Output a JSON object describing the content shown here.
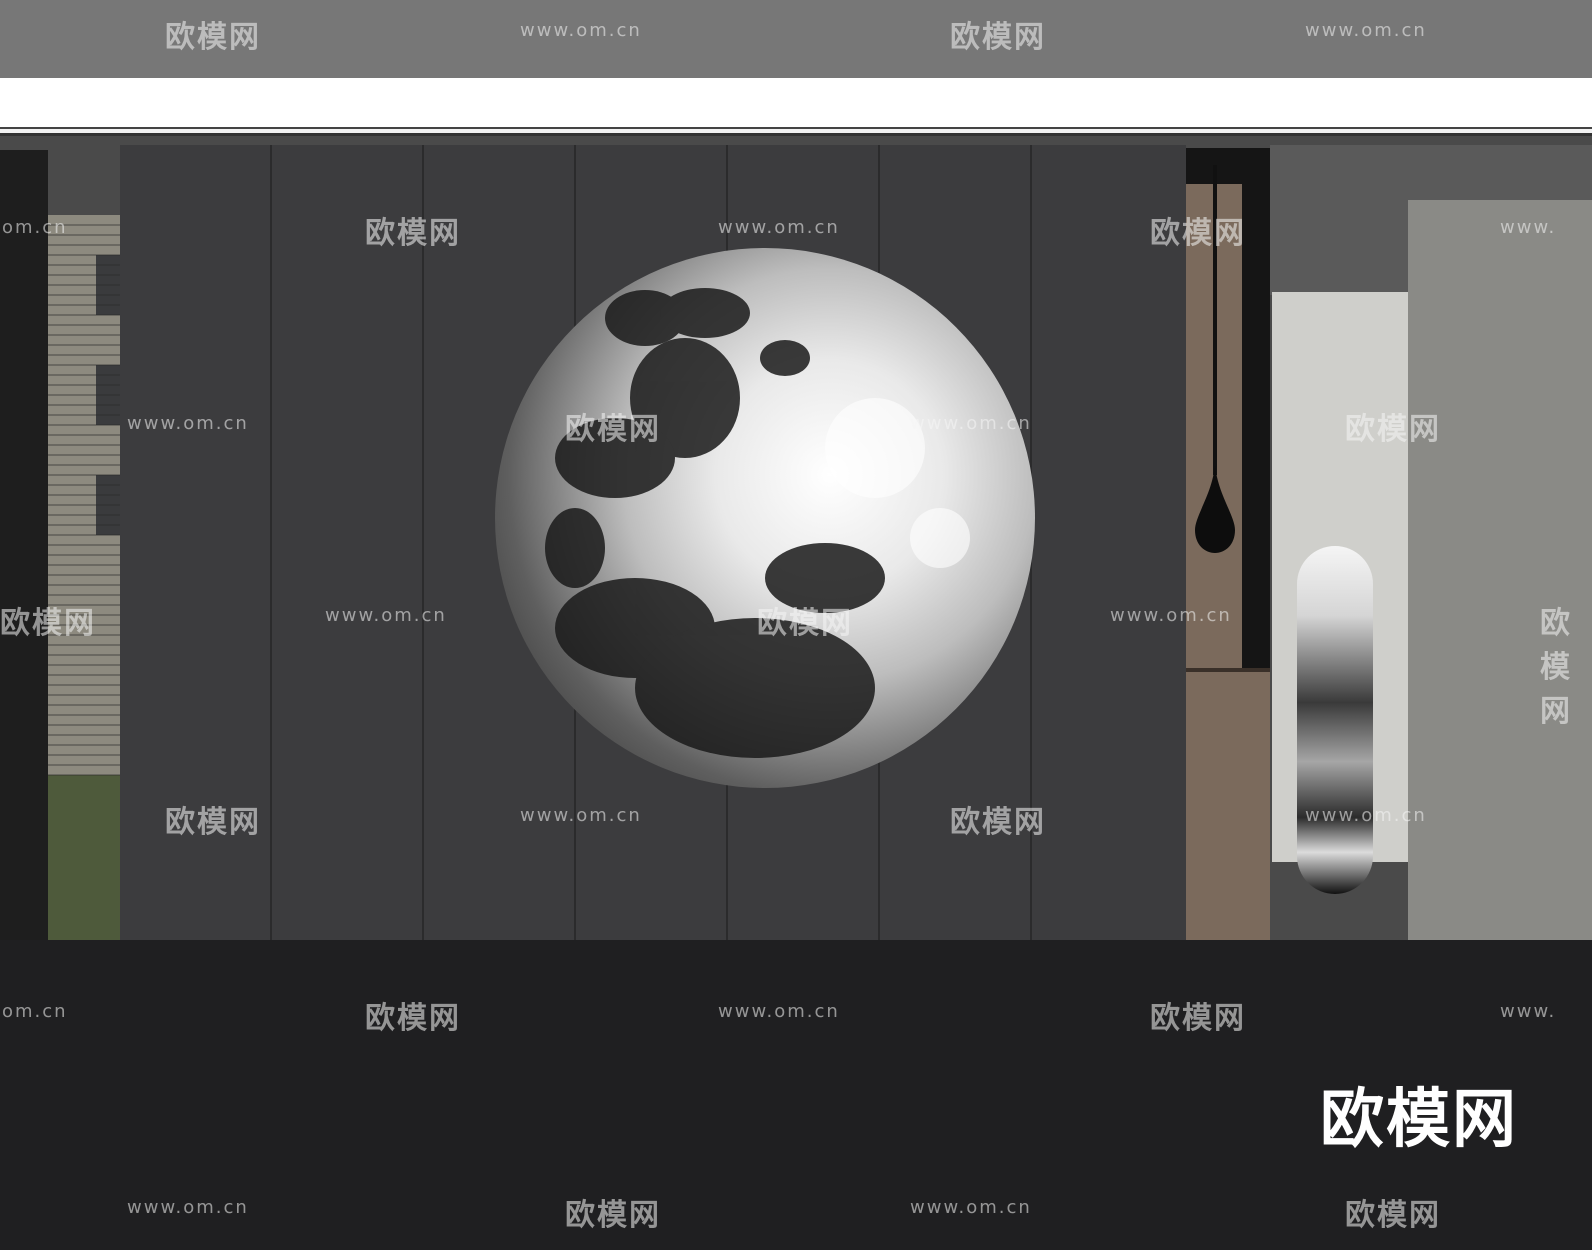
{
  "watermarks": {
    "url_text": "www.om.cn",
    "logo_text": "欧模网",
    "url_partial_left": "om.cn",
    "url_partial_right": "www.",
    "logo_partial": "欧模网"
  },
  "brand_logo_text": "欧模网",
  "scene": {
    "description_colors": {
      "panel_wall": "#3c3c3e",
      "wood": "#7b6a5c",
      "floor": "#1f1f21",
      "ceiling": "#777777"
    }
  }
}
